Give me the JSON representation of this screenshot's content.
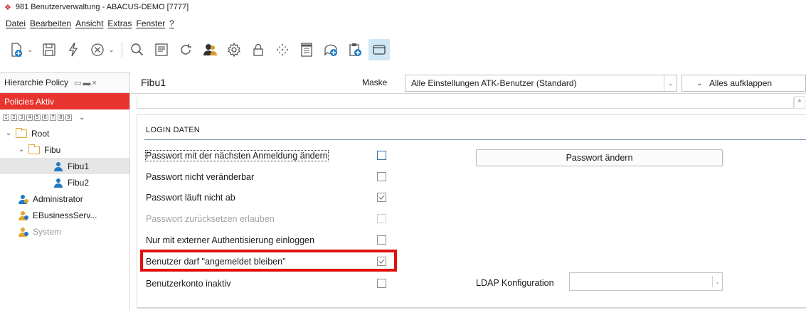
{
  "window": {
    "title": "981 Benutzerverwaltung - ABACUS-DEMO [7777]"
  },
  "menu": [
    "Datei",
    "Bearbeiten",
    "Ansicht",
    "Extras",
    "Fenster",
    "?"
  ],
  "toolbar": {
    "icons": [
      "new-document-icon",
      "save-icon",
      "lightning-icon",
      "cancel-icon",
      "search-icon",
      "notes-icon",
      "refresh-icon",
      "users-icon",
      "settings-icon",
      "lock-icon",
      "sparkle-icon",
      "document-icon",
      "add-comment-icon",
      "clipboard-add-icon",
      "window-icon"
    ]
  },
  "left_panel": {
    "title": "Hierarchie Policy",
    "policies_label": "Policies Aktiv",
    "levels": [
      "1",
      "2",
      "3",
      "4",
      "5",
      "6",
      "7",
      "8",
      "9"
    ],
    "tree": {
      "root": "Root",
      "fibu": "Fibu",
      "fibu1": "Fibu1",
      "fibu2": "Fibu2",
      "admin": "Administrator",
      "ebusiness": "EBusinessServ...",
      "system": "System"
    }
  },
  "main": {
    "title": "Fibu1",
    "maske_label": "Maske",
    "maske_value": "Alle Einstellungen ATK-Benutzer (Standard)",
    "expand_label": "Alles aufklappen"
  },
  "section": {
    "title": "LOGIN DATEN",
    "rows": [
      {
        "label": "Passwort mit der nächsten Anmeldung ändern",
        "checked": false
      },
      {
        "label": "Passwort nicht veränderbar",
        "checked": false
      },
      {
        "label": "Passwort läuft nicht ab",
        "checked": true
      },
      {
        "label": "Passwort zurücksetzen erlauben",
        "checked": false,
        "disabled": true
      },
      {
        "label": "Nur mit externer Authentisierung einloggen",
        "checked": false
      },
      {
        "label": "Benutzer darf \"angemeldet bleiben\"",
        "checked": true
      },
      {
        "label": "Benutzerkonto inaktiv",
        "checked": false
      }
    ],
    "change_password_button": "Passwort ändern",
    "ldap_label": "LDAP Konfiguration",
    "ldap_value": ""
  },
  "colors": {
    "accent_red": "#e8342e",
    "highlight_red": "#e01010",
    "active_tool": "#cfe6f6",
    "section_line": "#6b8fb3"
  }
}
